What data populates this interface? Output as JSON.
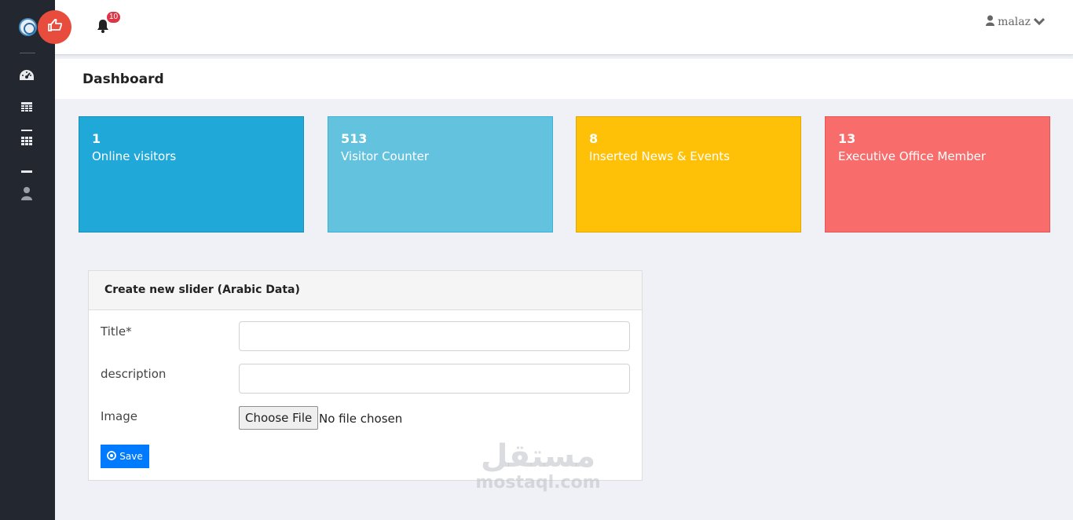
{
  "app": {
    "logo_icon": "emblem-logo-icon"
  },
  "colors": {
    "sidebar_bg": "#232830",
    "accent_red": "#e74c3c",
    "card_blue": "#20a8d8",
    "card_light_blue": "#63c2de",
    "card_yellow": "#ffc107",
    "card_red": "#f86c6b",
    "primary_button": "#007bff"
  },
  "sidebar": {
    "items": [
      {
        "icon": "speedometer-icon"
      },
      {
        "icon": "table-icon"
      },
      {
        "icon": "grid-icon"
      },
      {
        "icon": "minus-icon"
      },
      {
        "icon": "user-icon"
      }
    ]
  },
  "topbar": {
    "toggle_icon": "thumbs-up-icon",
    "notifications": {
      "icon": "bell-icon",
      "count": "10"
    },
    "user": {
      "name": "malaz",
      "icon": "user-icon",
      "chevron": "chevron-down-icon"
    }
  },
  "page": {
    "title": "Dashboard"
  },
  "stats": [
    {
      "value": "1",
      "label": "Online visitors"
    },
    {
      "value": "513",
      "label": "Visitor Counter"
    },
    {
      "value": "8",
      "label": "Inserted News & Events"
    },
    {
      "value": "13",
      "label": "Executive Office Member"
    }
  ],
  "form": {
    "title": "Create new slider (Arabic Data)",
    "fields": {
      "title": {
        "label": "Title*",
        "value": ""
      },
      "description": {
        "label": "description",
        "value": ""
      },
      "image": {
        "label": "Image",
        "button": "Choose File",
        "status": "No file chosen"
      }
    },
    "save_label": "Save",
    "save_icon": "circle-dot-icon"
  },
  "watermark": {
    "arabic": "مستقل",
    "latin": "mostaql.com"
  }
}
